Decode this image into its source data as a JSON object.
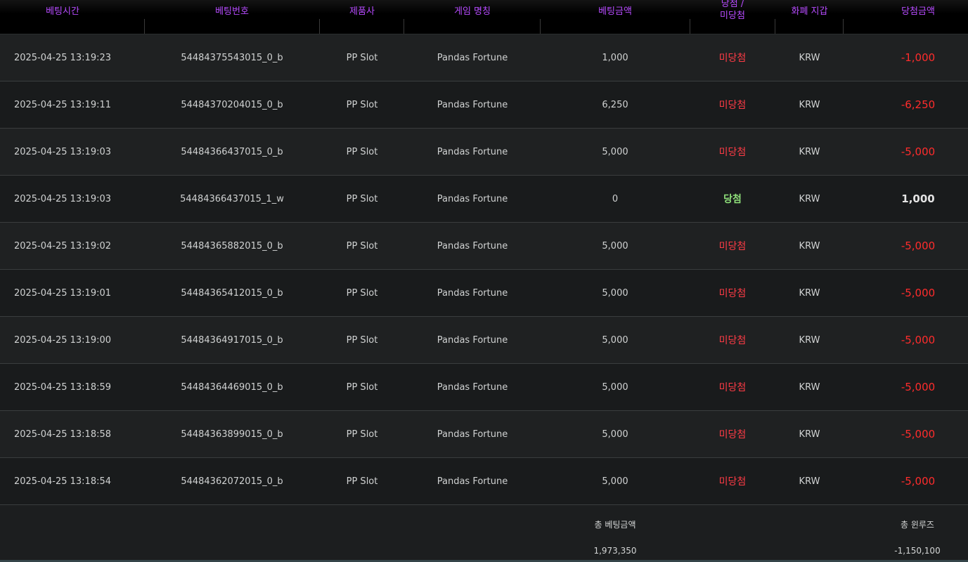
{
  "columns": {
    "bet_time": "베팅시간",
    "bet_no": "베팅번호",
    "provider": "제품사",
    "game_name": "게임 명칭",
    "bet_amount": "베팅금액",
    "result_line1": "당첨 /",
    "result_line2": "미당첨",
    "currency": "화폐 지갑",
    "win_amount": "당첨금액"
  },
  "rows": [
    {
      "time": "2025-04-25 13:19:23",
      "no": "54484375543015_0_b",
      "provider": "PP Slot",
      "game": "Pandas Fortune",
      "bet": "1,000",
      "result": "미당첨",
      "win": false,
      "currency": "KRW",
      "amount": "-1,000"
    },
    {
      "time": "2025-04-25 13:19:11",
      "no": "54484370204015_0_b",
      "provider": "PP Slot",
      "game": "Pandas Fortune",
      "bet": "6,250",
      "result": "미당첨",
      "win": false,
      "currency": "KRW",
      "amount": "-6,250"
    },
    {
      "time": "2025-04-25 13:19:03",
      "no": "54484366437015_0_b",
      "provider": "PP Slot",
      "game": "Pandas Fortune",
      "bet": "5,000",
      "result": "미당첨",
      "win": false,
      "currency": "KRW",
      "amount": "-5,000"
    },
    {
      "time": "2025-04-25 13:19:03",
      "no": "54484366437015_1_w",
      "provider": "PP Slot",
      "game": "Pandas Fortune",
      "bet": "0",
      "result": "당첨",
      "win": true,
      "currency": "KRW",
      "amount": "1,000"
    },
    {
      "time": "2025-04-25 13:19:02",
      "no": "54484365882015_0_b",
      "provider": "PP Slot",
      "game": "Pandas Fortune",
      "bet": "5,000",
      "result": "미당첨",
      "win": false,
      "currency": "KRW",
      "amount": "-5,000"
    },
    {
      "time": "2025-04-25 13:19:01",
      "no": "54484365412015_0_b",
      "provider": "PP Slot",
      "game": "Pandas Fortune",
      "bet": "5,000",
      "result": "미당첨",
      "win": false,
      "currency": "KRW",
      "amount": "-5,000"
    },
    {
      "time": "2025-04-25 13:19:00",
      "no": "54484364917015_0_b",
      "provider": "PP Slot",
      "game": "Pandas Fortune",
      "bet": "5,000",
      "result": "미당첨",
      "win": false,
      "currency": "KRW",
      "amount": "-5,000"
    },
    {
      "time": "2025-04-25 13:18:59",
      "no": "54484364469015_0_b",
      "provider": "PP Slot",
      "game": "Pandas Fortune",
      "bet": "5,000",
      "result": "미당첨",
      "win": false,
      "currency": "KRW",
      "amount": "-5,000"
    },
    {
      "time": "2025-04-25 13:18:58",
      "no": "54484363899015_0_b",
      "provider": "PP Slot",
      "game": "Pandas Fortune",
      "bet": "5,000",
      "result": "미당첨",
      "win": false,
      "currency": "KRW",
      "amount": "-5,000"
    },
    {
      "time": "2025-04-25 13:18:54",
      "no": "54484362072015_0_b",
      "provider": "PP Slot",
      "game": "Pandas Fortune",
      "bet": "5,000",
      "result": "미당첨",
      "win": false,
      "currency": "KRW",
      "amount": "-5,000"
    }
  ],
  "totals": {
    "bet_label": "총 베팅금액",
    "bet_value": "1,973,350",
    "winloss_label": "총 윈루즈",
    "winloss_value": "-1,150,100"
  },
  "colors": {
    "header_text": "#b74bff",
    "lose_text": "#ff3b45",
    "win_text": "#8fe07a",
    "negative_amount": "#ff2c2c"
  }
}
